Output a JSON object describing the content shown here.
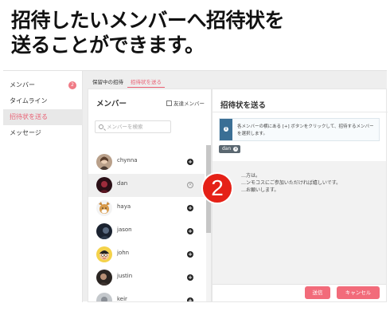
{
  "caption": {
    "line1": "招待したいメンバーへ招待状を",
    "line2": "送ることができます。"
  },
  "sidebar": {
    "items": [
      {
        "label": "メンバー",
        "badge": "2"
      },
      {
        "label": "タイムライン"
      },
      {
        "label": "招待状を送る",
        "active": true
      },
      {
        "label": "メッセージ"
      }
    ]
  },
  "tabs": [
    {
      "label": "保留中の招待"
    },
    {
      "label": "招待状を送る",
      "active": true
    }
  ],
  "member_panel": {
    "title": "メンバー",
    "friends_label": "友達メンバー",
    "search_placeholder": "メンバーを検索",
    "members": [
      {
        "name": "chynna",
        "action": "add"
      },
      {
        "name": "dan",
        "action": "remove"
      },
      {
        "name": "haya",
        "action": "add"
      },
      {
        "name": "jason",
        "action": "add"
      },
      {
        "name": "john",
        "action": "add"
      },
      {
        "name": "justin",
        "action": "add"
      },
      {
        "name": "keir",
        "action": "add"
      }
    ]
  },
  "invite_panel": {
    "title": "招待状を送る",
    "info": "各メンバーの横にある [+] ボタンをクリックして、招待するメンバーを選択します。",
    "selected_tag": "dan",
    "message": "…方は。\n…ンモコスにご参加いただければ嬉しいです。\n…お願いします。",
    "send_label": "送信",
    "cancel_label": "キャンセル"
  },
  "step_badge": "2",
  "colors": {
    "accent": "#f26b7a",
    "info": "#3a6f95",
    "step": "#e52117"
  }
}
